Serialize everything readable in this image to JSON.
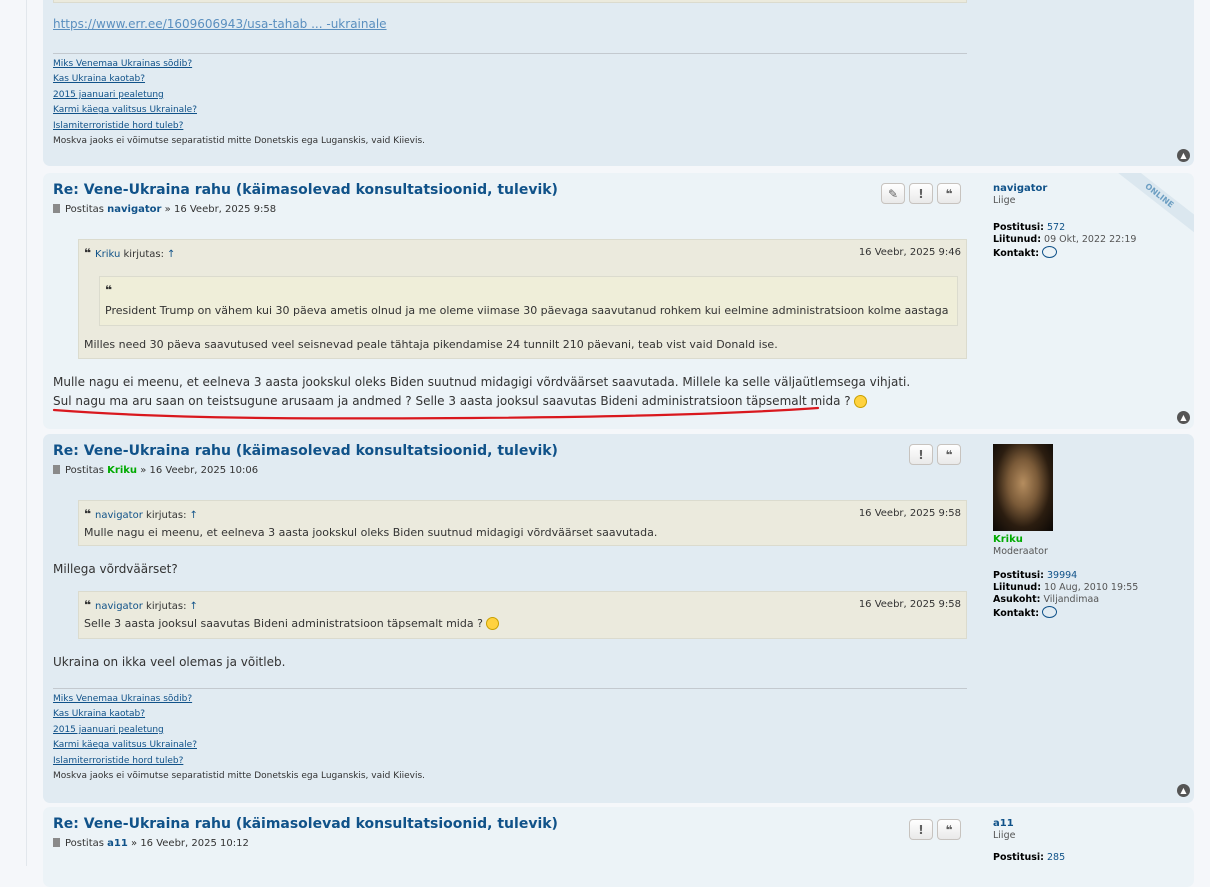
{
  "first_post": {
    "url": "https://www.err.ee/1609606943/usa-tahab ... -ukrainale",
    "signature": {
      "links": [
        "Miks Venemaa Ukrainas sõdib?",
        "Kas Ukraina kaotab?",
        "2015 jaanuari pealetung",
        "Karmi käega valitsus Ukrainale?",
        "Islamiterroristide hord tuleb?"
      ],
      "note": "Moskva jaoks ei võimutse separatistid mitte Donetskis ega Luganskis, vaid Kiievis."
    }
  },
  "posts": [
    {
      "title": "Re: Vene-Ukraina rahu (käimasolevad konsultatsioonid, tulevik)",
      "by_label": "Postitas",
      "author": "navigator",
      "date": "» 16 Veebr, 2025 9:58",
      "quote": {
        "who": "Kriku",
        "says": "kirjutas:",
        "date": "16 Veebr, 2025 9:46",
        "inner_text": "President Trump on vähem kui 30 päeva ametis olnud ja me oleme viimase 30 päevaga saavutanud rohkem kui eelmine administratsioon kolme aastaga",
        "text": "Milles need 30 päeva saavutused veel seisnevad peale tähtaja pikendamise 24 tunnilt 210 päevani, teab vist vaid Donald ise."
      },
      "body": [
        "Mulle nagu ei meenu, et eelneva 3 aasta jookskul oleks Biden suutnud midagigi võrdväärset saavutada. Millele ka selle väljaütlemsega vihjati.",
        "Sul nagu ma aru saan on teistsugune arusaam ja andmed ? Selle 3 aasta jooksul saavutas Bideni administratsioon täpsemalt mida ?"
      ],
      "profile": {
        "username": "navigator",
        "rank": "Liige",
        "posts_label": "Postitusi:",
        "posts": "572",
        "joined_label": "Liitunud:",
        "joined": "09 Okt, 2022 22:19",
        "contact_label": "Kontakt:",
        "online": "ONLINE"
      }
    },
    {
      "title": "Re: Vene-Ukraina rahu (käimasolevad konsultatsioonid, tulevik)",
      "by_label": "Postitas",
      "author": "Kriku",
      "date": "» 16 Veebr, 2025 10:06",
      "quote1": {
        "who": "navigator",
        "says": "kirjutas:",
        "date": "16 Veebr, 2025 9:58",
        "text": "Mulle nagu ei meenu, et eelneva 3 aasta jookskul oleks Biden suutnud midagigi võrdväärset saavutada."
      },
      "text1": "Millega võrdväärset?",
      "quote2": {
        "who": "navigator",
        "says": "kirjutas:",
        "date": "16 Veebr, 2025 9:58",
        "text": "Selle 3 aasta jooksul saavutas Bideni administratsioon täpsemalt mida ?"
      },
      "text2": "Ukraina on ikka veel olemas ja võitleb.",
      "signature": {
        "links": [
          "Miks Venemaa Ukrainas sõdib?",
          "Kas Ukraina kaotab?",
          "2015 jaanuari pealetung",
          "Karmi käega valitsus Ukrainale?",
          "Islamiterroristide hord tuleb?"
        ],
        "note": "Moskva jaoks ei võimutse separatistid mitte Donetskis ega Luganskis, vaid Kiievis."
      },
      "profile": {
        "username": "Kriku",
        "rank": "Moderaator",
        "posts_label": "Postitusi:",
        "posts": "39994",
        "joined_label": "Liitunud:",
        "joined": "10 Aug, 2010 19:55",
        "location_label": "Asukoht:",
        "location": "Viljandimaa",
        "contact_label": "Kontakt:"
      }
    },
    {
      "title": "Re: Vene-Ukraina rahu (käimasolevad konsultatsioonid, tulevik)",
      "by_label": "Postitas",
      "author": "a11",
      "date": "» 16 Veebr, 2025 10:12",
      "profile": {
        "username": "a11",
        "rank": "Liige",
        "posts_label": "Postitusi:",
        "posts": "285"
      }
    }
  ],
  "icons": {
    "edit": "pencil-icon",
    "report": "exclamation-icon",
    "quote": "quote-icon",
    "top": "arrow-up-icon",
    "contact": "chat-bubble-icon"
  },
  "colors": {
    "post_bg": "#e1ebf2",
    "link": "#105289",
    "moderator": "#00aa00",
    "quote_bg": "#ebeadd",
    "annotation": "#d9181e"
  }
}
